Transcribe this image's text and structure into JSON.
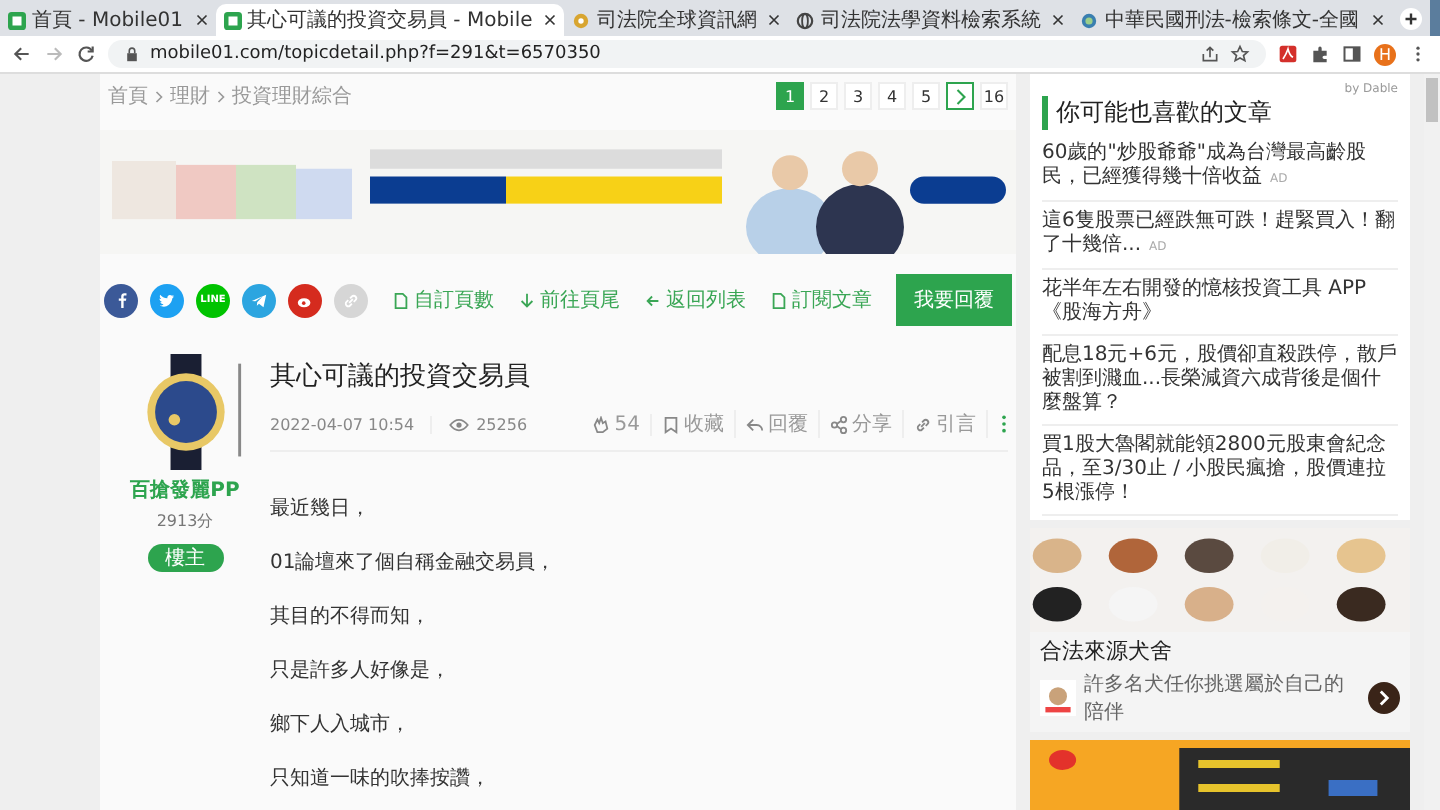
{
  "browser": {
    "tabs": [
      {
        "label": "首頁 - Mobile01",
        "kind": "site",
        "selected": false
      },
      {
        "label": "其心可議的投資交易員 - Mobile",
        "kind": "site",
        "selected": true
      },
      {
        "label": "司法院全球資訊網",
        "kind": "gov",
        "selected": false
      },
      {
        "label": "司法院法學資料檢索系統",
        "kind": "globe",
        "selected": false
      },
      {
        "label": "中華民國刑法-檢索條文-全國",
        "kind": "law",
        "selected": false
      }
    ],
    "url": "mobile01.com/topicdetail.php?f=291&t=6570350",
    "profile": "H"
  },
  "breadcrumb": [
    "首頁",
    "理財",
    "投資理財綜合"
  ],
  "pagination": [
    {
      "label": "1",
      "kind": "page",
      "selected": true
    },
    {
      "label": "2",
      "kind": "page",
      "selected": false
    },
    {
      "label": "3",
      "kind": "page",
      "selected": false
    },
    {
      "label": "4",
      "kind": "page",
      "selected": false
    },
    {
      "label": "5",
      "kind": "page",
      "selected": false
    },
    {
      "kind": "next"
    },
    {
      "label": "16",
      "kind": "page",
      "selected": false
    }
  ],
  "share": [
    {
      "kind": "facebook"
    },
    {
      "kind": "twitter"
    },
    {
      "kind": "line",
      "label": "LINE"
    },
    {
      "kind": "telegram"
    },
    {
      "kind": "weibo"
    },
    {
      "kind": "link"
    }
  ],
  "actions": [
    {
      "label": "自訂頁數",
      "kind": "page"
    },
    {
      "label": "前往頁尾",
      "kind": "bottom"
    },
    {
      "label": "返回列表",
      "kind": "back"
    },
    {
      "label": "訂閱文章",
      "kind": "subscribe"
    }
  ],
  "reply_button": "我要回覆",
  "author": {
    "name": "百搶發麗PP",
    "score": "2913分",
    "badge": "樓主"
  },
  "post": {
    "title": "其心可議的投資交易員",
    "date": "2022-04-07 10:54",
    "views": "25256",
    "tools": [
      {
        "kind": "clap",
        "label": "54"
      },
      {
        "kind": "bookmark",
        "label": "收藏"
      },
      {
        "kind": "reply",
        "label": "回覆"
      },
      {
        "kind": "share",
        "label": "分享"
      },
      {
        "kind": "quote",
        "label": "引言"
      },
      {
        "kind": "more"
      }
    ],
    "body": [
      "最近幾日，",
      "01論壇來了個自稱金融交易員，",
      "其目的不得而知，",
      "只是許多人好像是，",
      "鄉下人入城市，",
      "只知道一味的吹捧按讚，"
    ]
  },
  "sidebar": {
    "provider": "by Dable",
    "title": "你可能也喜歡的文章",
    "articles": [
      {
        "text": "60歲的\"炒股爺爺\"成為台灣最高齡股民，已經獲得幾十倍收益",
        "ad_mark": "AD"
      },
      {
        "text": "這6隻股票已經跌無可跌！趕緊買入！翻了十幾倍...",
        "ad_mark": "AD"
      },
      {
        "text": "花半年左右開發的憶核投資工具 APP《股海方舟》"
      },
      {
        "text": "配息18元+6元，股價卻直殺跌停，散戶被割到濺血...長榮減資六成背後是個什麼盤算？"
      },
      {
        "text": "買1股大魯閣就能領2800元股東會紀念品，至3/30止 / 小股民瘋搶，股價連拉5根漲停！"
      }
    ],
    "dog_ad": {
      "headline": "合法來源犬舍",
      "text": "許多名犬任你挑選屬於自己的陪伴"
    }
  }
}
